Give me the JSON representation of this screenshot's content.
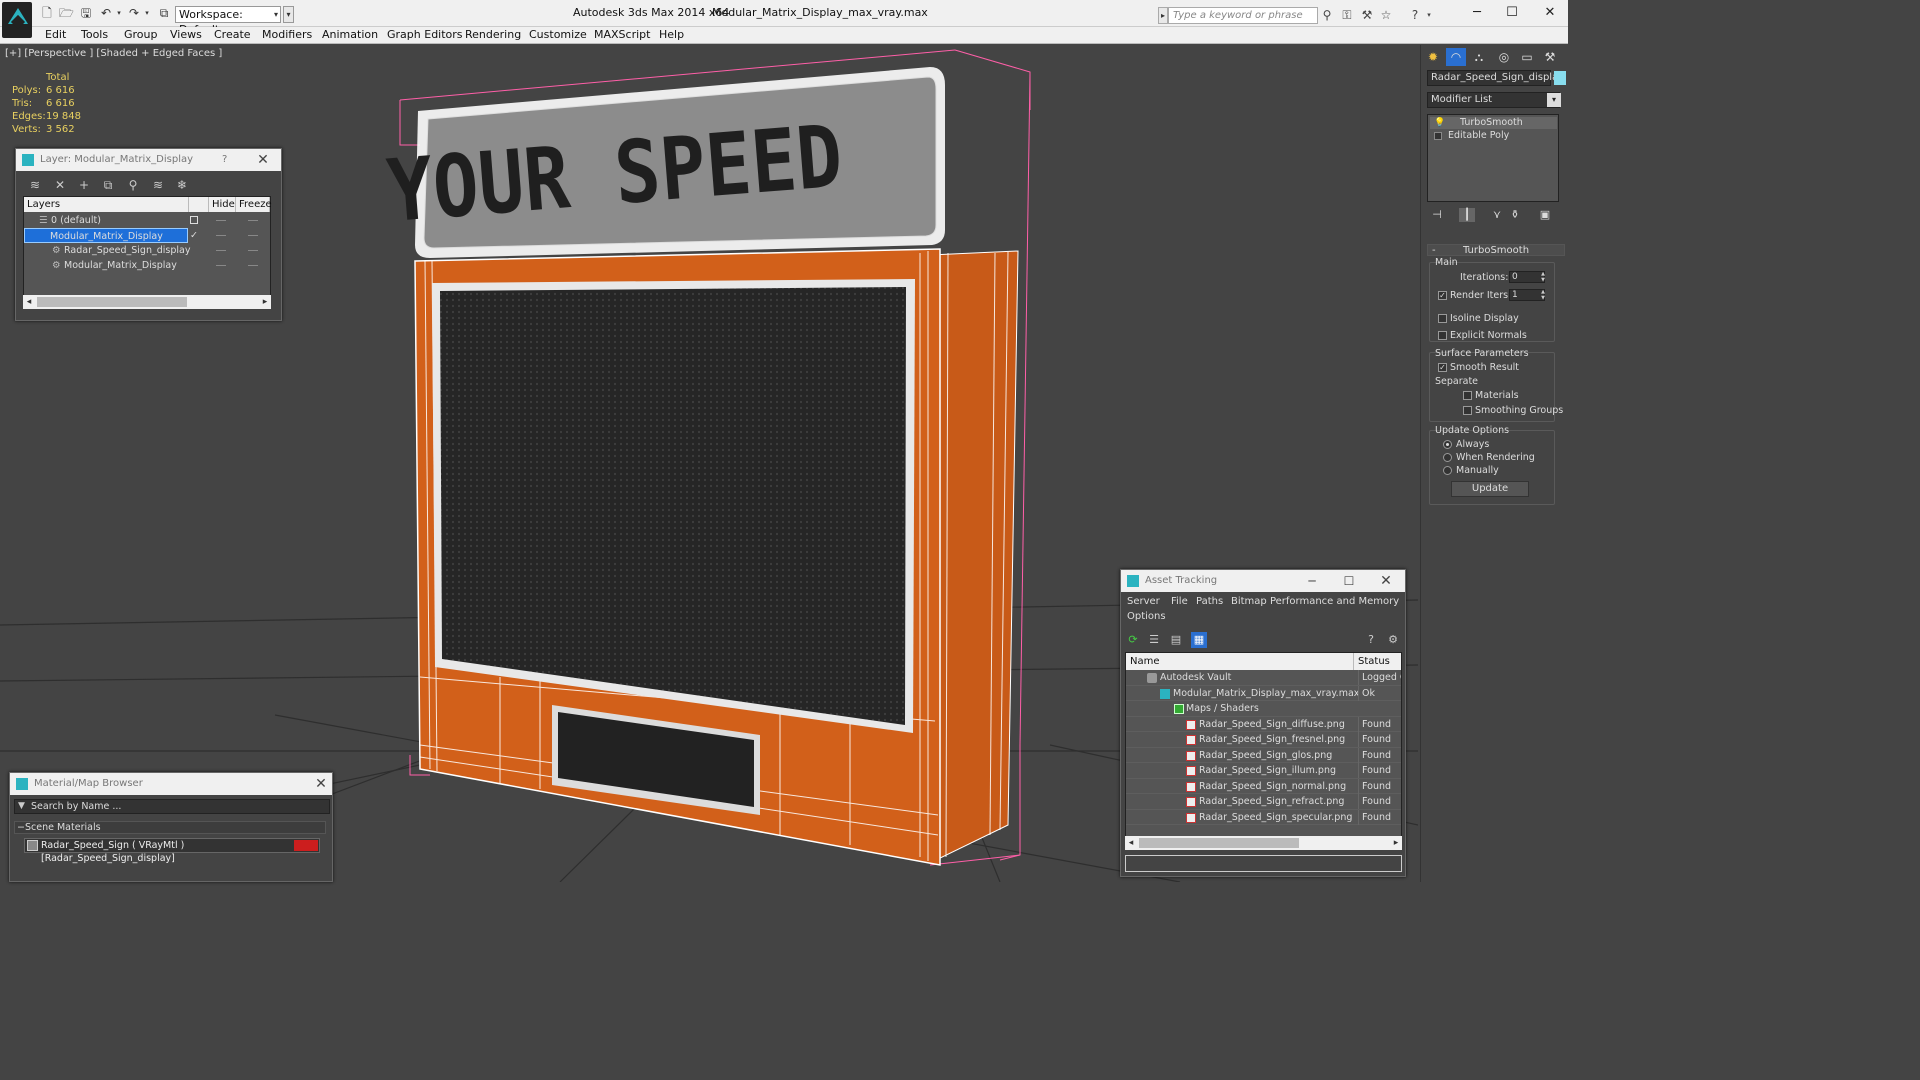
{
  "window": {
    "app_title": "Autodesk 3ds Max  2014 x64",
    "file_title": "Modular_Matrix_Display_max_vray.max",
    "workspace": "Workspace: Default",
    "search_placeholder": "Type a keyword or phrase"
  },
  "menu": [
    "Edit",
    "Tools",
    "Group",
    "Views",
    "Create",
    "Modifiers",
    "Animation",
    "Graph Editors",
    "Rendering",
    "Customize",
    "MAXScript",
    "Help"
  ],
  "viewport": {
    "label": "[+] [Perspective ] [Shaded + Edged Faces ]",
    "sign_text": "YOUR SPEED",
    "stats": {
      "header": "Total",
      "polys_label": "Polys:",
      "polys": "6 616",
      "tris_label": "Tris:",
      "tris": "6 616",
      "edges_label": "Edges:",
      "edges": "19 848",
      "verts_label": "Verts:",
      "verts": "3 562"
    },
    "colors": {
      "housing": "#d2601a",
      "screen": "#2a2a2a",
      "wire": "#ffffff",
      "bbox": "#ff66aa"
    }
  },
  "layer_dialog": {
    "title": "Layer: Modular_Matrix_Display",
    "help": "?",
    "col_layers": "Layers",
    "col_hide": "Hide",
    "col_freeze": "Freeze",
    "rows": [
      {
        "name": "0 (default)",
        "indent": 1
      },
      {
        "name": "Modular_Matrix_Display",
        "indent": 1
      },
      {
        "name": "Radar_Speed_Sign_display",
        "indent": 2
      },
      {
        "name": "Modular_Matrix_Display",
        "indent": 2
      }
    ]
  },
  "material_browser": {
    "title": "Material/Map Browser",
    "search_placeholder": "Search by Name ...",
    "section": "Scene Materials",
    "material": "Radar_Speed_Sign  ( VRayMtl ) [Radar_Speed_Sign_display]",
    "swatch_color": "#cc1e1e"
  },
  "asset_tracking": {
    "title": "Asset Tracking",
    "menu": [
      "Server",
      "File",
      "Paths",
      "Bitmap Performance and Memory",
      "Options"
    ],
    "col_name": "Name",
    "col_status": "Status",
    "rows": [
      {
        "name": "Autodesk Vault",
        "status": "Logged Ou"
      },
      {
        "name": "Modular_Matrix_Display_max_vray.max",
        "status": "Ok"
      },
      {
        "name": "Maps / Shaders",
        "status": ""
      },
      {
        "name": "Radar_Speed_Sign_diffuse.png",
        "status": "Found"
      },
      {
        "name": "Radar_Speed_Sign_fresnel.png",
        "status": "Found"
      },
      {
        "name": "Radar_Speed_Sign_glos.png",
        "status": "Found"
      },
      {
        "name": "Radar_Speed_Sign_illum.png",
        "status": "Found"
      },
      {
        "name": "Radar_Speed_Sign_normal.png",
        "status": "Found"
      },
      {
        "name": "Radar_Speed_Sign_refract.png",
        "status": "Found"
      },
      {
        "name": "Radar_Speed_Sign_specular.png",
        "status": "Found"
      }
    ]
  },
  "command_panel": {
    "object_name": "Radar_Speed_Sign_display",
    "object_color": "#88ddee",
    "modifier_list": "Modifier List",
    "stack": [
      "TurboSmooth",
      "Editable Poly"
    ],
    "rollout_title": "TurboSmooth",
    "main_group": "Main",
    "iterations_label": "Iterations:",
    "iterations": "0",
    "render_iters_label": "Render Iters:",
    "render_iters": "1",
    "render_iters_checked": true,
    "isoline": "Isoline Display",
    "explicit_normals": "Explicit Normals",
    "surface_group": "Surface Parameters",
    "smooth_result": "Smooth Result",
    "separate": "Separate",
    "materials": "Materials",
    "smoothing_groups": "Smoothing Groups",
    "update_group": "Update Options",
    "always": "Always",
    "when_rendering": "When Rendering",
    "manually": "Manually",
    "update_btn": "Update"
  }
}
